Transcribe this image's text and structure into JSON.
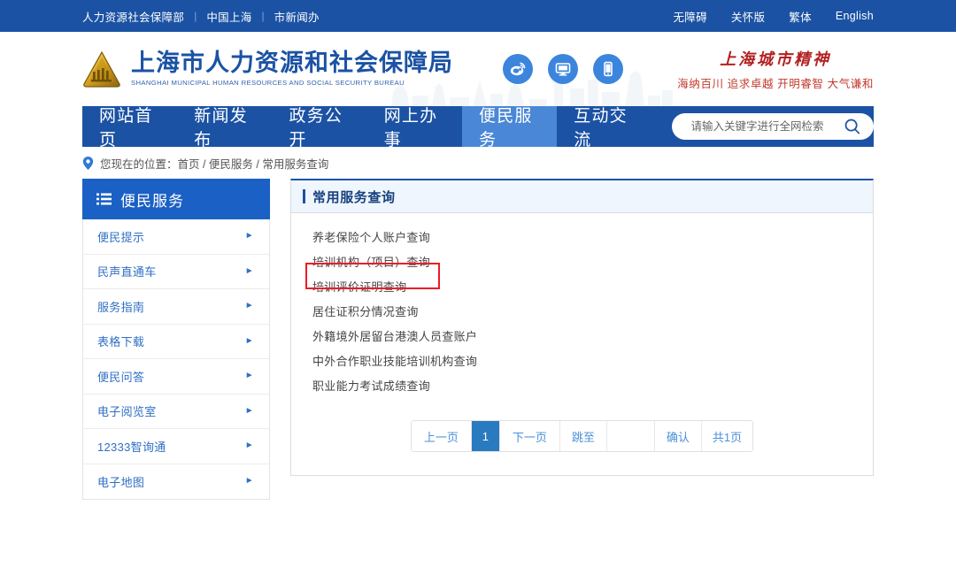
{
  "topbar": {
    "links": [
      {
        "label": "人力资源社会保障部"
      },
      {
        "label": "中国上海"
      },
      {
        "label": "市新闻办"
      }
    ],
    "separator": "|",
    "right_links": [
      {
        "label": "无障碍"
      },
      {
        "label": "关怀版"
      },
      {
        "label": "繁体"
      },
      {
        "label": "English"
      }
    ]
  },
  "header": {
    "logo_cn": "上海市人力资源和社会保障局",
    "logo_en": "SHANGHAI MUNICIPAL HUMAN RESOURCES AND SOCIAL SECURITY BUREAU",
    "icons": [
      {
        "name": "weibo-icon"
      },
      {
        "name": "desktop-icon"
      },
      {
        "name": "mobile-icon"
      }
    ],
    "spirit_title": "上海城市精神",
    "spirit_sub": "海纳百川 追求卓越 开明睿智 大气谦和"
  },
  "nav": {
    "items": [
      {
        "label": "网站首页",
        "active": false
      },
      {
        "label": "新闻发布",
        "active": false
      },
      {
        "label": "政务公开",
        "active": false
      },
      {
        "label": "网上办事",
        "active": false
      },
      {
        "label": "便民服务",
        "active": true
      },
      {
        "label": "互动交流",
        "active": false
      }
    ],
    "search": {
      "placeholder": "请输入关键字进行全网检索",
      "value": ""
    }
  },
  "breadcrumb": {
    "icon": "location-pin-icon",
    "label": "您现在的位置：",
    "trail": "首页 / 便民服务 / 常用服务查询"
  },
  "sidebar": {
    "title": "便民服务",
    "icon": "list-menu-icon",
    "items": [
      {
        "label": "便民提示",
        "arrow": "►"
      },
      {
        "label": "民声直通车",
        "arrow": "►"
      },
      {
        "label": "服务指南",
        "arrow": "►"
      },
      {
        "label": "表格下载",
        "arrow": "►"
      },
      {
        "label": "便民问答",
        "arrow": "►"
      },
      {
        "label": "电子阅览室",
        "arrow": "►"
      },
      {
        "label": "12333智询通",
        "arrow": "►"
      },
      {
        "label": "电子地图",
        "arrow": "►"
      }
    ]
  },
  "panel": {
    "title": "常用服务查询",
    "services": [
      {
        "label": "养老保险个人账户查询",
        "highlighted": false
      },
      {
        "label": "培训机构（项目）查询",
        "highlighted": true
      },
      {
        "label": "培训评价证明查询",
        "highlighted": false
      },
      {
        "label": "居住证积分情况查询",
        "highlighted": false
      },
      {
        "label": "外籍境外居留台港澳人员查账户",
        "highlighted": false
      },
      {
        "label": "中外合作职业技能培训机构查询",
        "highlighted": false
      },
      {
        "label": "职业能力考试成绩查询",
        "highlighted": false
      }
    ]
  },
  "pagination": {
    "prev": "上一页",
    "current_page": "1",
    "next": "下一页",
    "jump_label": "跳至",
    "jump_value": "",
    "confirm": "确认",
    "total": "共1页"
  },
  "colors": {
    "brand_blue": "#1b52a4",
    "nav_active": "#4a87d6",
    "link_blue": "#2f6fc4",
    "annotation_red": "#ee1c25",
    "spirit_red": "#b22222"
  }
}
